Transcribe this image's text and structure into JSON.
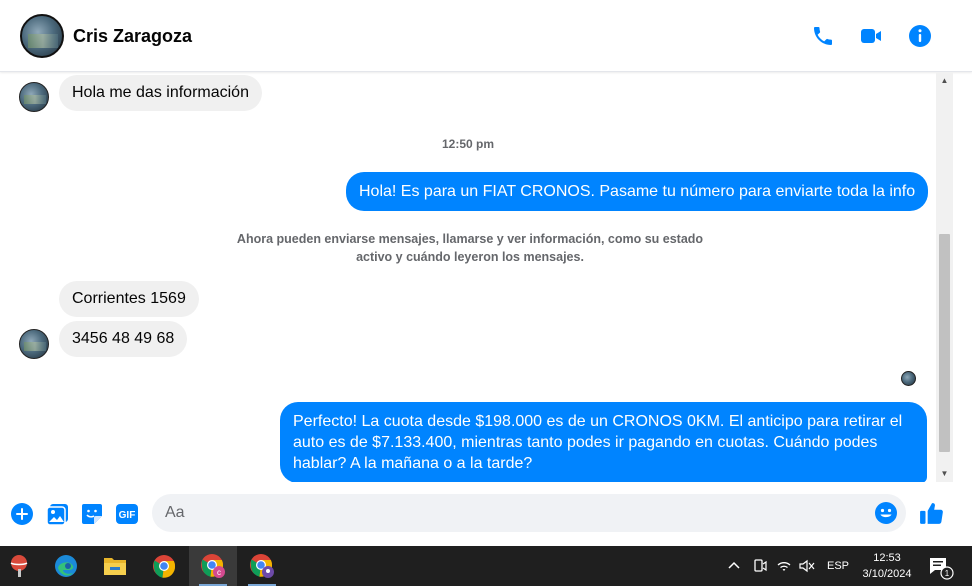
{
  "header": {
    "contact_name": "Cris Zaragoza",
    "icons": [
      "phone-icon",
      "video-camera-icon",
      "info-icon"
    ]
  },
  "conversation": {
    "msg1": "Hola me das información",
    "timestamp": "12:50 pm",
    "msg2": "Hola! Es para un FIAT CRONOS. Pasame tu número para enviarte toda la info",
    "system_note": "Ahora pueden enviarse mensajes, llamarse y ver información, como su estado activo y cuándo leyeron los mensajes.",
    "msg3": "Corrientes 1569",
    "msg4": "3456 48 49 68",
    "msg5": "Perfecto! La cuota desde $198.000 es de un CRONOS 0KM. El anticipo para retirar el auto es de $7.133.400, mientras tanto podes ir pagando en cuotas. Cuándo podes hablar? A la mañana o a la tarde?"
  },
  "composer": {
    "placeholder": "Aa",
    "gif_label": "GIF"
  },
  "taskbar": {
    "language": "ESP",
    "time": "12:53",
    "date": "3/10/2024",
    "notification_count": "1"
  },
  "colors": {
    "accent": "#0084ff",
    "incoming_bubble": "#f0f0f0",
    "taskbar": "#1f1f1f"
  }
}
